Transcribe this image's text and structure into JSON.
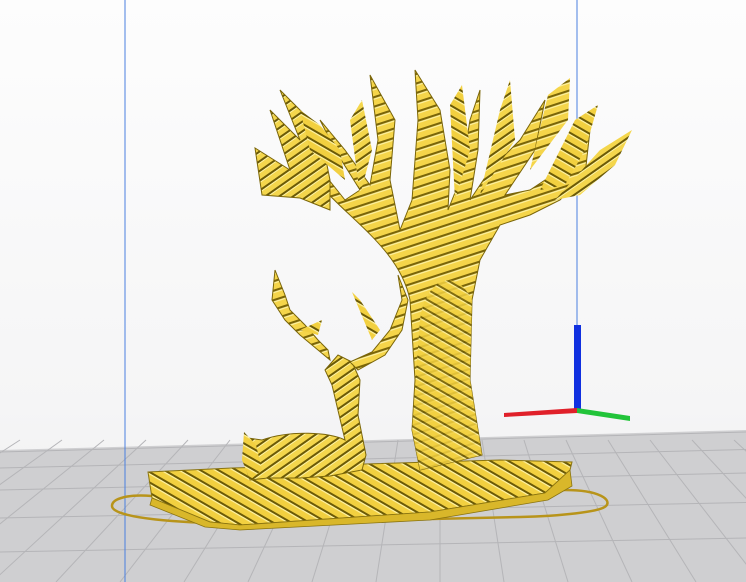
{
  "app": {
    "view": "3d-print-preview",
    "model_color": "#f5d54a",
    "model_stripe_color": "#6b5a06",
    "bed_color": "#cfcfd1",
    "grid_color": "#b9b9bc",
    "axis_colors": {
      "x": "#e0202a",
      "y": "#22c43a",
      "z": "#1030e0"
    },
    "build_volume_line_color": "#4a7fe0",
    "icons": [
      "tree-icon",
      "deer-icon"
    ]
  }
}
